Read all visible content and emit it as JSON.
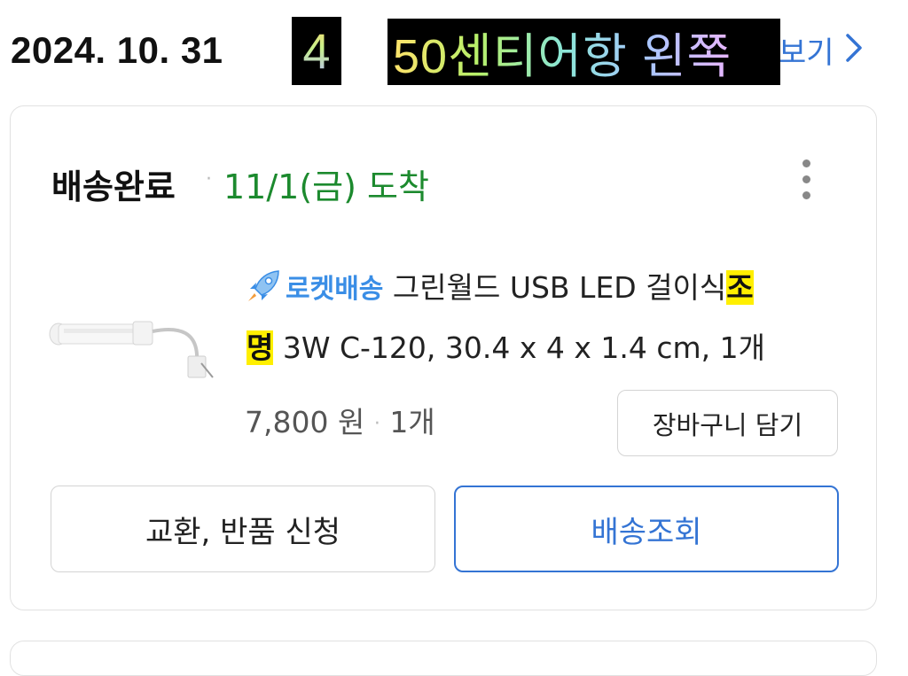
{
  "header": {
    "date": "2024. 10. 31",
    "overlay_number": "4",
    "overlay_location": "50센티어항 왼쪽",
    "view_link_partial": "보기"
  },
  "order_card": {
    "status": "배송완료",
    "separator": "·",
    "arrival": "11/1(금) 도착",
    "product": {
      "rocket_label": "로켓배송",
      "title_before": " 그린월드 USB LED 걸이식",
      "highlight_1": "조",
      "highlight_2": "명",
      "title_after": " 3W C-120, 30.4 x 4 x 1.4 cm, 1개",
      "price": "7,800 원",
      "price_sep": "·",
      "quantity": "1개"
    },
    "cart_button": "장바구니 담기",
    "exchange_button": "교환, 반품 신청",
    "track_button": "배송조회"
  },
  "colors": {
    "arrival_green": "#1c8a2e",
    "link_blue": "#3474d4",
    "rocket_blue": "#3a8ee6",
    "highlight_yellow": "#ffef00"
  }
}
